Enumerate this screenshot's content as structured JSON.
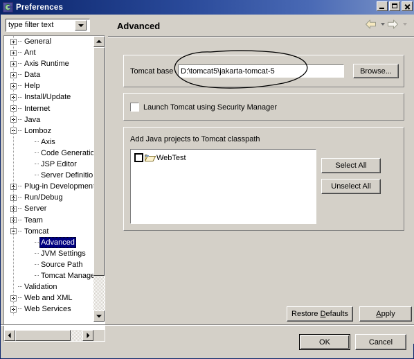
{
  "window": {
    "title": "Preferences",
    "icon": "eclipse-icon",
    "buttons": {
      "minimize": "minimize-icon",
      "maximize": "maximize-icon",
      "close": "close-icon"
    }
  },
  "filter": {
    "value": "type filter text",
    "placeholder": "type filter text",
    "dropdown_icon": "chevron-down-icon"
  },
  "tree": {
    "items": [
      {
        "label": "General",
        "level": 0,
        "expander": "plus",
        "selected": false
      },
      {
        "label": "Ant",
        "level": 0,
        "expander": "plus",
        "selected": false
      },
      {
        "label": "Axis Runtime",
        "level": 0,
        "expander": "plus",
        "selected": false
      },
      {
        "label": "Data",
        "level": 0,
        "expander": "plus",
        "selected": false
      },
      {
        "label": "Help",
        "level": 0,
        "expander": "plus",
        "selected": false
      },
      {
        "label": "Install/Update",
        "level": 0,
        "expander": "plus",
        "selected": false
      },
      {
        "label": "Internet",
        "level": 0,
        "expander": "plus",
        "selected": false
      },
      {
        "label": "Java",
        "level": 0,
        "expander": "plus",
        "selected": false
      },
      {
        "label": "Lomboz",
        "level": 0,
        "expander": "minus",
        "selected": false
      },
      {
        "label": "Axis",
        "level": 1,
        "expander": "none",
        "selected": false
      },
      {
        "label": "Code Generation",
        "level": 1,
        "expander": "none",
        "selected": false
      },
      {
        "label": "JSP Editor",
        "level": 1,
        "expander": "none",
        "selected": false
      },
      {
        "label": "Server Definitions",
        "level": 1,
        "expander": "none",
        "selected": false
      },
      {
        "label": "Plug-in Development",
        "level": 0,
        "expander": "plus",
        "selected": false
      },
      {
        "label": "Run/Debug",
        "level": 0,
        "expander": "plus",
        "selected": false
      },
      {
        "label": "Server",
        "level": 0,
        "expander": "plus",
        "selected": false
      },
      {
        "label": "Team",
        "level": 0,
        "expander": "plus",
        "selected": false
      },
      {
        "label": "Tomcat",
        "level": 0,
        "expander": "minus",
        "selected": false
      },
      {
        "label": "Advanced",
        "level": 1,
        "expander": "none",
        "selected": true
      },
      {
        "label": "JVM Settings",
        "level": 1,
        "expander": "none",
        "selected": false
      },
      {
        "label": "Source Path",
        "level": 1,
        "expander": "none",
        "selected": false
      },
      {
        "label": "Tomcat Manager A",
        "level": 1,
        "expander": "none",
        "selected": false
      },
      {
        "label": "Validation",
        "level": 0,
        "expander": "none",
        "selected": false
      },
      {
        "label": "Web and XML",
        "level": 0,
        "expander": "plus",
        "selected": false
      },
      {
        "label": "Web Services",
        "level": 0,
        "expander": "plus",
        "selected": false
      }
    ]
  },
  "page": {
    "title": "Advanced",
    "nav": {
      "back_icon": "back-arrow-icon",
      "back_dropdown_icon": "chevron-down-icon",
      "forward_icon": "forward-arrow-icon",
      "forward_dropdown_icon": "chevron-down-icon"
    },
    "tomcat_base": {
      "label": "Tomcat base",
      "value": "D:\\tomcat5\\jakarta-tomcat-5",
      "browse_label": "Browse..."
    },
    "security": {
      "checkbox_label": "Launch Tomcat using Security Manager",
      "checked": false
    },
    "classpath": {
      "group_label": "Add Java projects to Tomcat classpath",
      "items": [
        {
          "label": "WebTest",
          "checked": false,
          "icon": "folder-icon"
        }
      ],
      "select_all_label": "Select All",
      "unselect_all_label": "Unselect All"
    }
  },
  "footer": {
    "restore_defaults_label": "Restore Defaults",
    "restore_defaults_mnemonic": "D",
    "apply_label": "Apply",
    "apply_mnemonic": "A",
    "ok_label": "OK",
    "cancel_label": "Cancel"
  },
  "annotation": {
    "type": "hand-drawn-ellipse",
    "color": "#000000",
    "target": "tomcat-base-input"
  },
  "colors": {
    "window_face": "#d4d0c8",
    "title_gradient_start": "#0a246a",
    "title_gradient_end": "#7e96c9",
    "selection": "#000080",
    "field_background": "#ffffff",
    "nav_arrow_enabled": "#f5e6b8"
  }
}
